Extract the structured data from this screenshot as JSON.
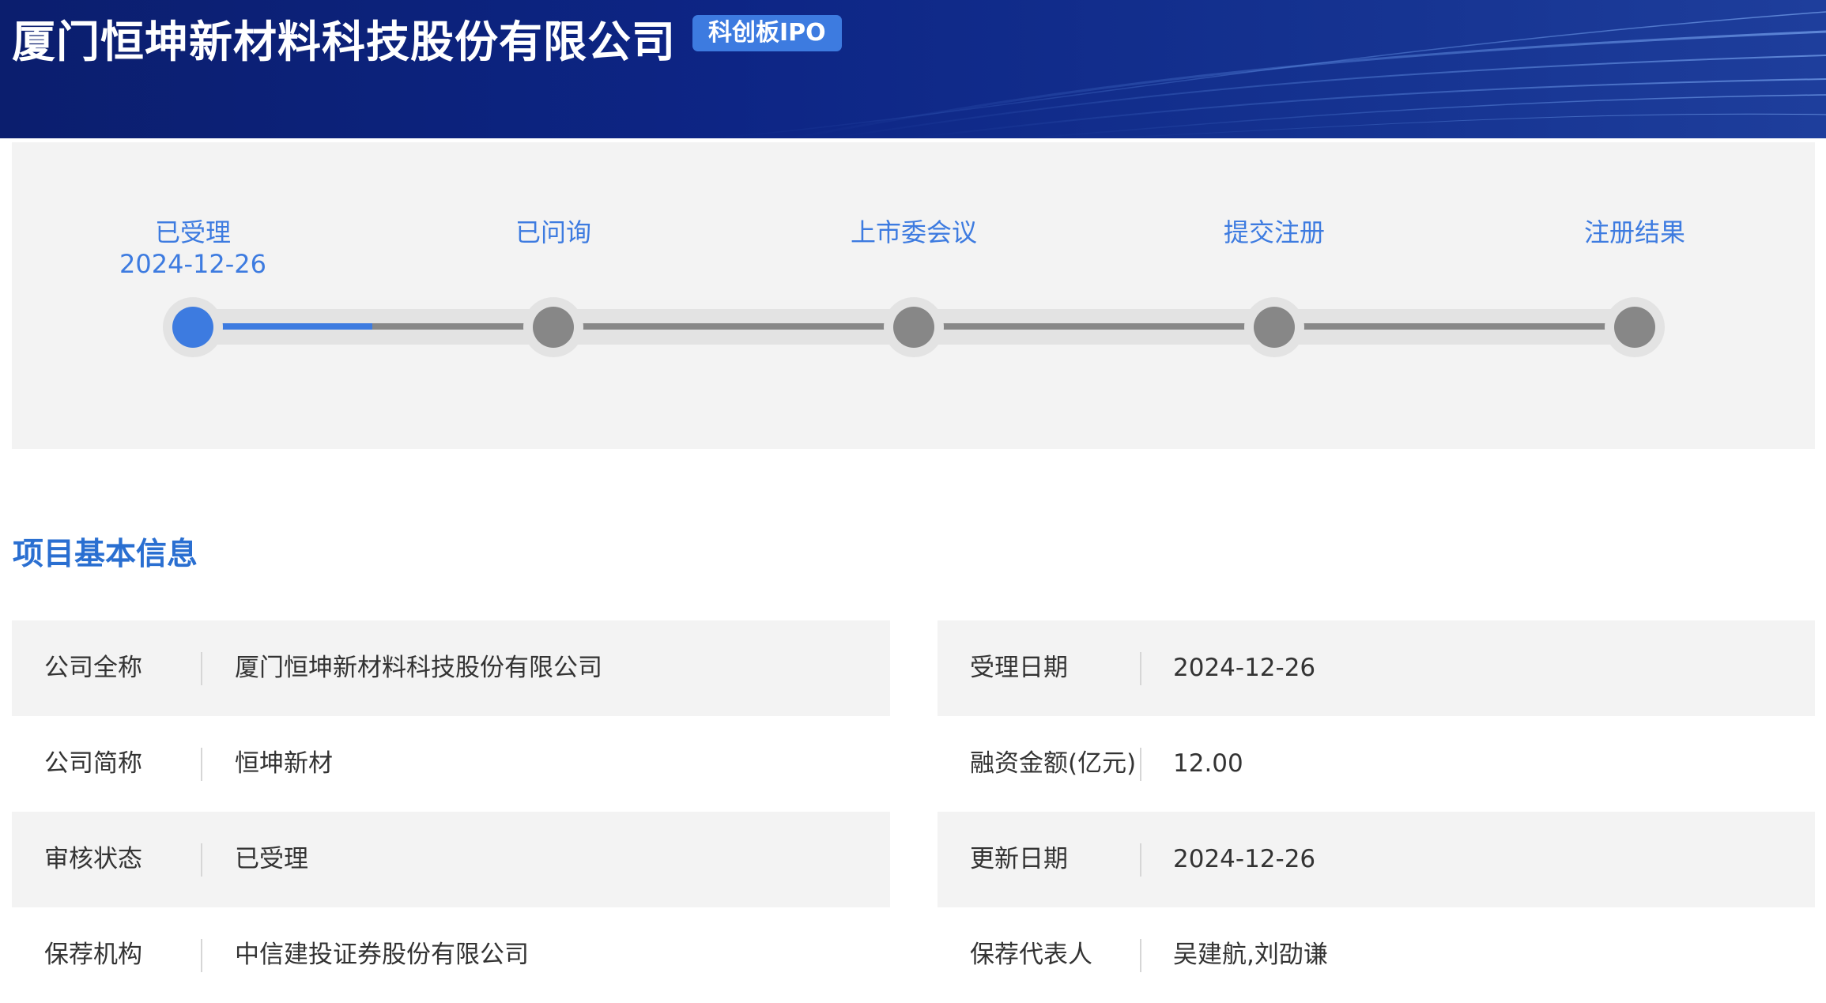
{
  "header": {
    "company_title": "厦门恒坤新材料科技股份有限公司",
    "board_badge": "科创板IPO"
  },
  "progress": {
    "steps": [
      {
        "label": "已受理",
        "date": "2024-12-26",
        "active": true
      },
      {
        "label": "已问询",
        "date": "",
        "active": false
      },
      {
        "label": "上市委会议",
        "date": "",
        "active": false
      },
      {
        "label": "提交注册",
        "date": "",
        "active": false
      },
      {
        "label": "注册结果",
        "date": "",
        "active": false
      }
    ],
    "fill_fraction_of_first_segment": 0.5
  },
  "section": {
    "title": "项目基本信息"
  },
  "info": {
    "left": [
      {
        "label": "公司全称",
        "value": "厦门恒坤新材料科技股份有限公司"
      },
      {
        "label": "公司简称",
        "value": "恒坤新材"
      },
      {
        "label": "审核状态",
        "value": "已受理"
      },
      {
        "label": "保荐机构",
        "value": "中信建投证券股份有限公司"
      }
    ],
    "right": [
      {
        "label": "受理日期",
        "value": "2024-12-26"
      },
      {
        "label": "融资金额(亿元)",
        "value": "12.00"
      },
      {
        "label": "更新日期",
        "value": "2024-12-26"
      },
      {
        "label": "保荐代表人",
        "value": "吴建航,刘劭谦"
      }
    ]
  },
  "colors": {
    "accent": "#3d7be0",
    "section_title": "#2a6fd1",
    "banner_dark": "#0b1e6e",
    "inactive_node": "#878787",
    "panel_bg": "#f3f3f3"
  }
}
